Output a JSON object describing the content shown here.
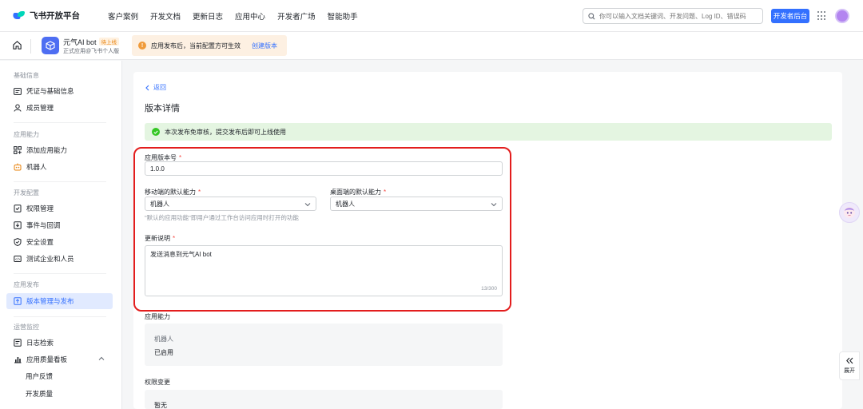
{
  "topnav": {
    "logo_text": "飞书开放平台",
    "items": [
      "客户案例",
      "开发文档",
      "更新日志",
      "应用中心",
      "开发者广场",
      "智能助手"
    ],
    "search_placeholder": "你可以输入文档关键词、开发问题、Log ID、错误码",
    "dev_console_label": "开发者后台"
  },
  "appbar": {
    "app_name": "元气AI bot",
    "app_badge": "待上线",
    "app_sub": "正式应用@飞书个人版",
    "notice_text": "应用发布后，当前配置方可生效",
    "notice_link": "创建版本"
  },
  "sidebar": {
    "sections": [
      {
        "title": "基础信息",
        "items": [
          "凭证与基础信息",
          "成员管理"
        ]
      },
      {
        "title": "应用能力",
        "items": [
          "添加应用能力",
          "机器人"
        ]
      },
      {
        "title": "开发配置",
        "items": [
          "权限管理",
          "事件与回调",
          "安全设置",
          "测试企业和人员"
        ]
      },
      {
        "title": "应用发布",
        "items": [
          "版本管理与发布"
        ]
      },
      {
        "title": "运营监控",
        "items": [
          "日志检索",
          "应用质量看板",
          "用户反馈",
          "开发质量"
        ]
      }
    ],
    "active": "版本管理与发布"
  },
  "main": {
    "back_label": "返回",
    "page_title": "版本详情",
    "success_text": "本次发布免审核，提交发布后即可上线使用",
    "form": {
      "version_label": "应用版本号",
      "version_value": "1.0.0",
      "mobile_label": "移动端的默认能力",
      "mobile_value": "机器人",
      "desktop_label": "桌面端的默认能力",
      "desktop_value": "机器人",
      "default_hint": "\"默认的应用功能\"即用户通过工作台访问应用时打开的功能",
      "notes_label": "更新说明",
      "notes_value": "发送消息到元气AI bot",
      "notes_counter": "13/300",
      "required_mark": "*"
    },
    "capability": {
      "title": "应用能力",
      "name": "机器人",
      "status": "已启用"
    },
    "permission": {
      "title": "权限变更",
      "value": "暂无"
    }
  },
  "right": {
    "expand_label": "展开"
  },
  "colors": {
    "accent": "#3370ff",
    "highlight_border": "#e31d1d",
    "success_bg": "#e4f5e1"
  }
}
